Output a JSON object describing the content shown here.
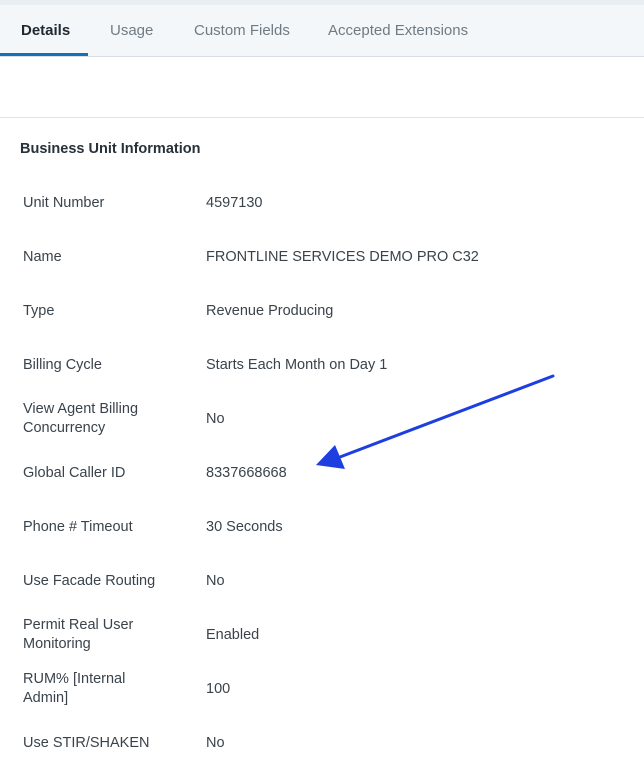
{
  "tabs": [
    {
      "label": "Details",
      "active": true
    },
    {
      "label": "Usage",
      "active": false
    },
    {
      "label": "Custom Fields",
      "active": false
    },
    {
      "label": "Accepted Extensions",
      "active": false
    }
  ],
  "section": {
    "title": "Business Unit Information",
    "rows": [
      {
        "label": "Unit Number",
        "value": "4597130"
      },
      {
        "label": "Name",
        "value": "FRONTLINE SERVICES DEMO PRO C32"
      },
      {
        "label": "Type",
        "value": "Revenue Producing"
      },
      {
        "label": "Billing Cycle",
        "value": "Starts Each Month on Day 1"
      },
      {
        "label": "View Agent Billing Concurrency",
        "value": "No"
      },
      {
        "label": "Global Caller ID",
        "value": "8337668668"
      },
      {
        "label": "Phone # Timeout",
        "value": "30 Seconds"
      },
      {
        "label": "Use Facade Routing",
        "value": "No"
      },
      {
        "label": "Permit Real User Monitoring",
        "value": "Enabled"
      },
      {
        "label": "RUM% [Internal Admin]",
        "value": "100"
      },
      {
        "label": "Use STIR/SHAKEN",
        "value": "No"
      }
    ]
  },
  "colors": {
    "accent": "#1670b7",
    "annotation_arrow": "#1d3fe0"
  },
  "annotation": {
    "icon": "arrow-annotation-icon",
    "points_to": "Global Caller ID"
  }
}
